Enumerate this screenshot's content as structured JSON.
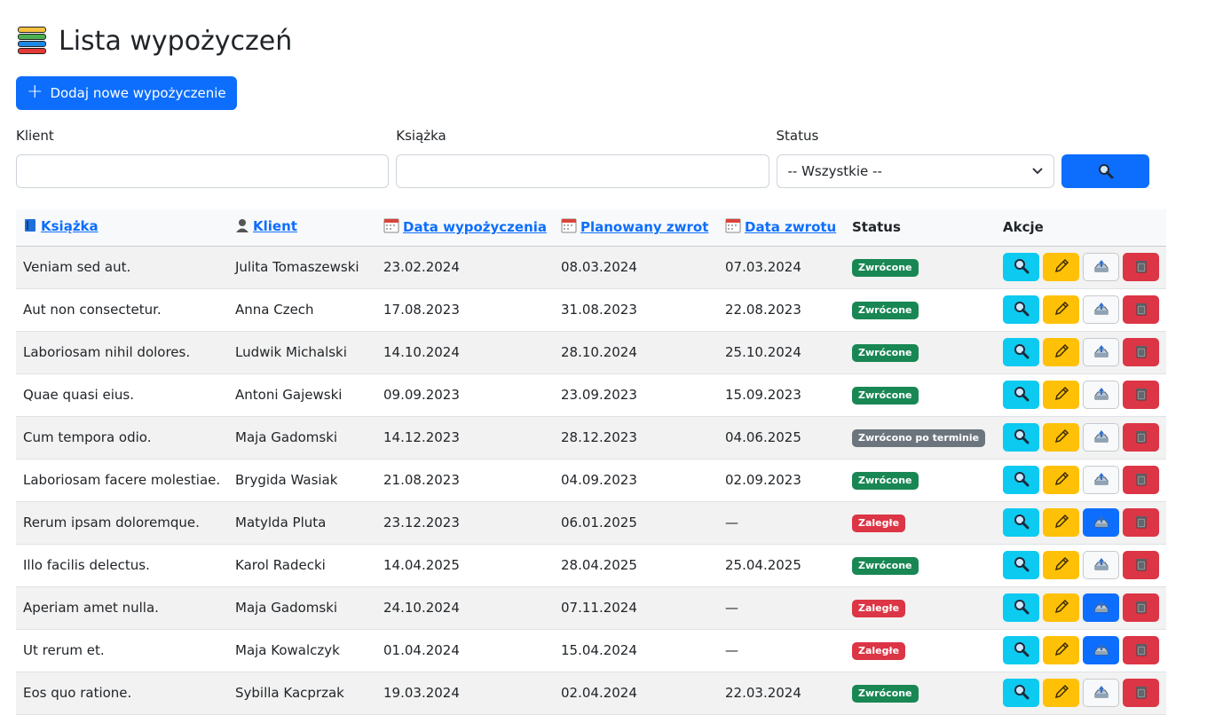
{
  "page": {
    "title": "Lista wypożyczeń",
    "add_button": "Dodaj nowe wypożyczenie"
  },
  "filters": {
    "client_label": "Klient",
    "client_value": "",
    "book_label": "Książka",
    "book_value": "",
    "status_label": "Status",
    "status_selected": "-- Wszystkie --"
  },
  "table": {
    "headers": {
      "book": "Książka",
      "client": "Klient",
      "loan_date": "Data wypożyczenia",
      "planned_return": "Planowany zwrot",
      "return_date": "Data zwrotu",
      "status": "Status",
      "actions": "Akcje"
    },
    "rows": [
      {
        "book": "Veniam sed aut.",
        "client": "Julita Tomaszewski",
        "loan_date": "23.02.2024",
        "planned_return": "08.03.2024",
        "return_date": "07.03.2024",
        "status": "Zwrócone",
        "status_color": "#198754",
        "returned": true
      },
      {
        "book": "Aut non consectetur.",
        "client": "Anna Czech",
        "loan_date": "17.08.2023",
        "planned_return": "31.08.2023",
        "return_date": "22.08.2023",
        "status": "Zwrócone",
        "status_color": "#198754",
        "returned": true
      },
      {
        "book": "Laboriosam nihil dolores.",
        "client": "Ludwik Michalski",
        "loan_date": "14.10.2024",
        "planned_return": "28.10.2024",
        "return_date": "25.10.2024",
        "status": "Zwrócone",
        "status_color": "#198754",
        "returned": true
      },
      {
        "book": "Quae quasi eius.",
        "client": "Antoni Gajewski",
        "loan_date": "09.09.2023",
        "planned_return": "23.09.2023",
        "return_date": "15.09.2023",
        "status": "Zwrócone",
        "status_color": "#198754",
        "returned": true
      },
      {
        "book": "Cum tempora odio.",
        "client": "Maja Gadomski",
        "loan_date": "14.12.2023",
        "planned_return": "28.12.2023",
        "return_date": "04.06.2025",
        "status": "Zwrócono po terminie",
        "status_color": "#6c757d",
        "returned": true
      },
      {
        "book": "Laboriosam facere molestiae.",
        "client": "Brygida Wasiak",
        "loan_date": "21.08.2023",
        "planned_return": "04.09.2023",
        "return_date": "02.09.2023",
        "status": "Zwrócone",
        "status_color": "#198754",
        "returned": true
      },
      {
        "book": "Rerum ipsam doloremque.",
        "client": "Matylda Pluta",
        "loan_date": "23.12.2023",
        "planned_return": "06.01.2025",
        "return_date": "—",
        "status": "Zaległe",
        "status_color": "#dc3545",
        "returned": false
      },
      {
        "book": "Illo facilis delectus.",
        "client": "Karol Radecki",
        "loan_date": "14.04.2025",
        "planned_return": "28.04.2025",
        "return_date": "25.04.2025",
        "status": "Zwrócone",
        "status_color": "#198754",
        "returned": true
      },
      {
        "book": "Aperiam amet nulla.",
        "client": "Maja Gadomski",
        "loan_date": "24.10.2024",
        "planned_return": "07.11.2024",
        "return_date": "—",
        "status": "Zaległe",
        "status_color": "#dc3545",
        "returned": false
      },
      {
        "book": "Ut rerum et.",
        "client": "Maja Kowalczyk",
        "loan_date": "01.04.2024",
        "planned_return": "15.04.2024",
        "return_date": "—",
        "status": "Zaległe",
        "status_color": "#dc3545",
        "returned": false
      },
      {
        "book": "Eos quo ratione.",
        "client": "Sybilla Kacprzak",
        "loan_date": "19.03.2024",
        "planned_return": "02.04.2024",
        "return_date": "22.03.2024",
        "status": "Zwrócone",
        "status_color": "#198754",
        "returned": true
      }
    ]
  },
  "icons": {
    "title": "books-icon",
    "add": "plus-icon",
    "search": "magnifier-icon",
    "book_header": "blue-book-icon",
    "client_header": "person-icon",
    "date_header": "calendar-icon",
    "view": "magnifier-icon",
    "edit": "pencil-icon",
    "return": "inbox-tray-icon",
    "delete": "wastebasket-icon"
  },
  "colors": {
    "primary": "#0d6efd",
    "info": "#0dcaf0",
    "warning": "#ffc107",
    "danger": "#dc3545",
    "success": "#198754",
    "secondary": "#6c757d"
  }
}
